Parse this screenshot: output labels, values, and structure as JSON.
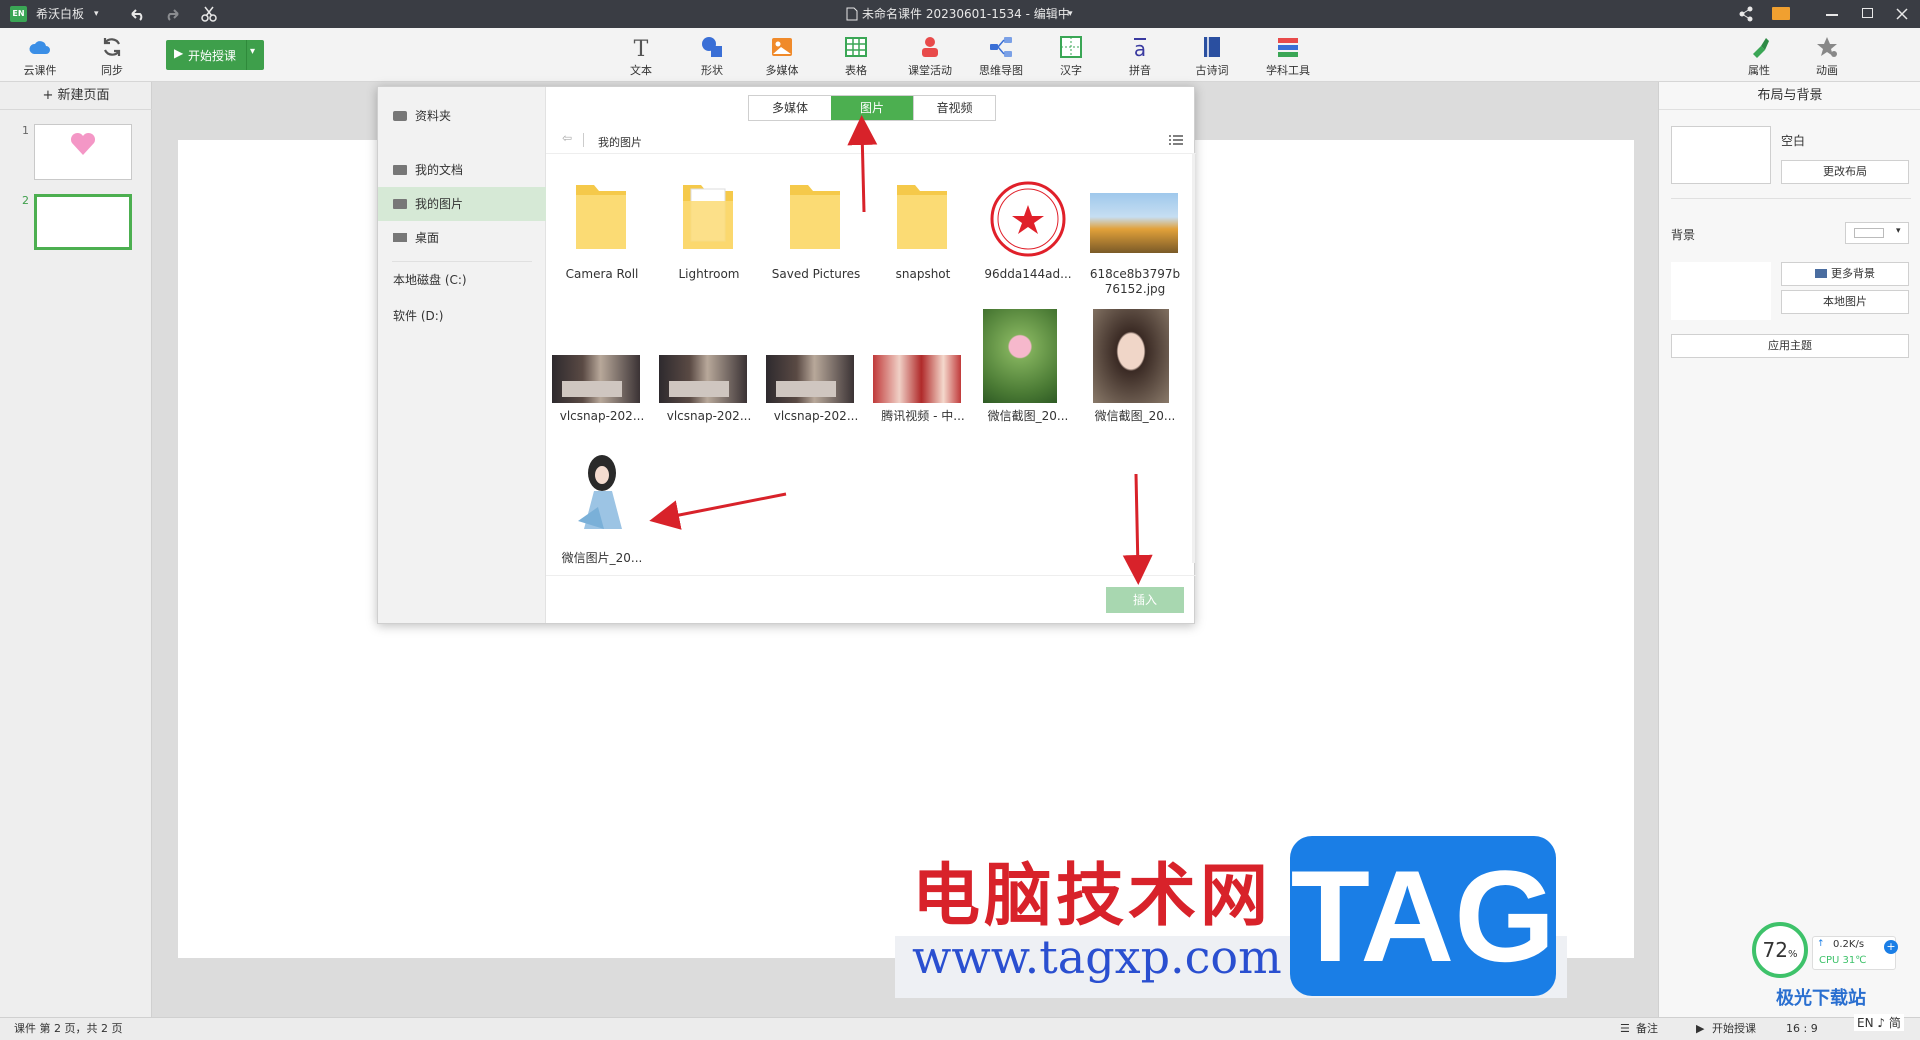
{
  "titlebar": {
    "app_name": "希沃白板",
    "app_badge": "EN",
    "document_title": "未命名课件 20230601-1534 - 编辑中",
    "icons": [
      "undo-icon",
      "redo-icon",
      "scissors-icon",
      "document-icon",
      "share-icon",
      "mail-icon",
      "minimize-icon",
      "restore-icon",
      "close-icon"
    ]
  },
  "toolbar": {
    "cloud_label": "云课件",
    "sync_label": "同步",
    "start_label": "开始授课",
    "tools": [
      {
        "label": "文本",
        "icon": "text-icon"
      },
      {
        "label": "形状",
        "icon": "shape-icon"
      },
      {
        "label": "多媒体",
        "icon": "multimedia-icon"
      },
      {
        "label": "表格",
        "icon": "table-icon"
      },
      {
        "label": "课堂活动",
        "icon": "class-activity-icon"
      },
      {
        "label": "思维导图",
        "icon": "mindmap-icon"
      },
      {
        "label": "汉字",
        "icon": "hanzi-icon"
      },
      {
        "label": "拼音",
        "icon": "pinyin-icon"
      },
      {
        "label": "古诗词",
        "icon": "poem-icon"
      },
      {
        "label": "学科工具",
        "icon": "subject-tools-icon"
      }
    ],
    "right_tools": [
      {
        "label": "属性",
        "icon": "brush-icon"
      },
      {
        "label": "动画",
        "icon": "animation-icon"
      }
    ]
  },
  "left_panel": {
    "new_page_label": "+ 新建页面",
    "pages": [
      {
        "number": "1"
      },
      {
        "number": "2"
      }
    ]
  },
  "dialog": {
    "sidebar": [
      {
        "label": "资料夹",
        "icon": "materials-icon"
      },
      {
        "label": "我的文档",
        "icon": "folder-icon"
      },
      {
        "label": "我的图片",
        "icon": "picture-icon",
        "active": true
      },
      {
        "label": "桌面",
        "icon": "desktop-icon"
      },
      {
        "label": "本地磁盘 (C:)",
        "icon": ""
      },
      {
        "label": "软件 (D:)",
        "icon": ""
      }
    ],
    "tabs": [
      {
        "label": "多媒体"
      },
      {
        "label": "图片",
        "active": true
      },
      {
        "label": "音视频"
      }
    ],
    "breadcrumb": "我的图片",
    "files": [
      {
        "name": "Camera Roll",
        "kind": "folder"
      },
      {
        "name": "Lightroom",
        "kind": "folder-doc"
      },
      {
        "name": "Saved Pictures",
        "kind": "folder"
      },
      {
        "name": "snapshot",
        "kind": "folder"
      },
      {
        "name": "96dda144ad...",
        "kind": "seal"
      },
      {
        "name": "618ce8b3797b\n76152.jpg",
        "kind": "tulips"
      },
      {
        "name": "vlcsnap-202...",
        "kind": "room"
      },
      {
        "name": "vlcsnap-202...",
        "kind": "room"
      },
      {
        "name": "vlcsnap-202...",
        "kind": "room"
      },
      {
        "name": "腾讯视频 - 中...",
        "kind": "people"
      },
      {
        "name": "微信截图_20...",
        "kind": "lotus"
      },
      {
        "name": "微信截图_20...",
        "kind": "portrait"
      },
      {
        "name": "微信图片_20...",
        "kind": "girl"
      }
    ],
    "insert_label": "插入"
  },
  "right_panel": {
    "title": "布局与背景",
    "layout_label": "空白",
    "change_layout": "更改布局",
    "background_label": "背景",
    "more_background": "更多背景",
    "local_image": "本地图片",
    "apply_theme": "应用主题"
  },
  "statusbar": {
    "pages_text": "课件 第 2 页，共 2 页",
    "notes_label": "备注",
    "start_label": "开始授课",
    "ratio": "16 : 9"
  },
  "watermark": {
    "line1": "电脑技术网",
    "line2": "www.tagxp.com",
    "tag": "TAG",
    "site": "极光下载站",
    "ime": "EN ♪ 简"
  },
  "monitor": {
    "percent": "72",
    "percent_unit": "%",
    "speed": "0.2K/s",
    "cpu": "CPU 31℃"
  },
  "colors": {
    "accent": "#4caf50",
    "annotation_arrow": "#d8222a"
  }
}
